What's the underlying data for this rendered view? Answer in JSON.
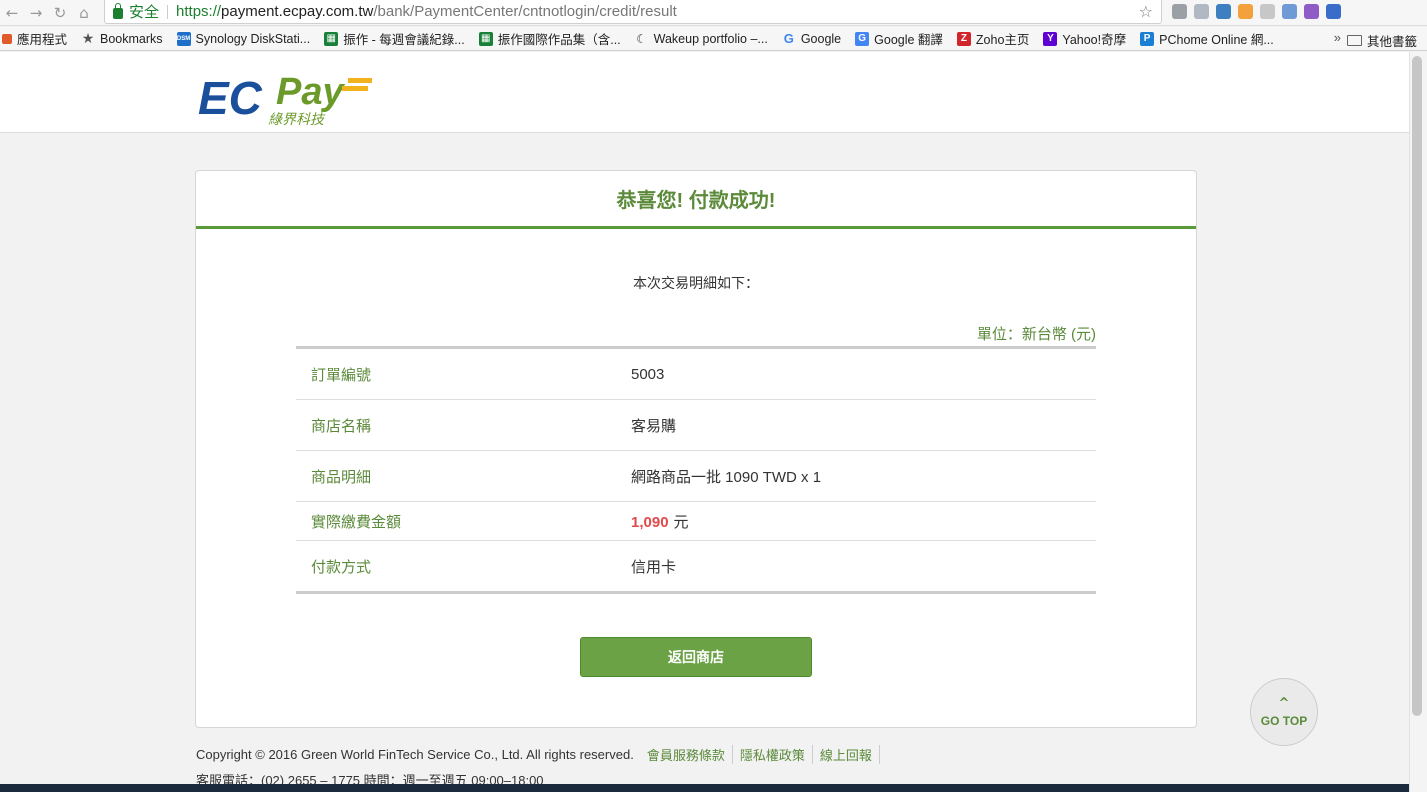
{
  "browser": {
    "secure_label": "安全",
    "url_https": "https://",
    "url_host": "payment.ecpay.com.tw",
    "url_path": "/bank/PaymentCenter/cntnotlogin/credit/result",
    "bookmarks": [
      {
        "label": "應用程式",
        "icon": "apps-icon",
        "color": "#e05a2b"
      },
      {
        "label": "Bookmarks",
        "icon": "star-icon",
        "color": "#555555"
      },
      {
        "label": "Synology DiskStati...",
        "icon": "synology-icon",
        "color": "#1e6fc9"
      },
      {
        "label": "振作 - 每週會議紀錄...",
        "icon": "sheets-icon",
        "color": "#188038"
      },
      {
        "label": "振作國際作品集（含...",
        "icon": "sheets-icon",
        "color": "#188038"
      },
      {
        "label": "Wakeup portfolio –...",
        "icon": "wakeup-icon",
        "color": "#333333"
      },
      {
        "label": "Google",
        "icon": "google-icon",
        "color": "#4285f4"
      },
      {
        "label": "Google 翻譯",
        "icon": "translate-icon",
        "color": "#4285f4"
      },
      {
        "label": "Zoho主页",
        "icon": "zoho-icon",
        "color": "#d4242b"
      },
      {
        "label": "Yahoo!奇摩",
        "icon": "yahoo-icon",
        "color": "#5f01d1"
      },
      {
        "label": "PChome Online 網...",
        "icon": "pchome-icon",
        "color": "#1a7fd4"
      }
    ],
    "bookmarks_more": "»",
    "other_bookmarks": "其他書籤"
  },
  "page": {
    "title": "恭喜您! 付款成功!",
    "subtitle": "本次交易明細如下：",
    "unit": "單位：新台幣 (元)",
    "rows": [
      {
        "label": "訂單編號",
        "value": "5003"
      },
      {
        "label": "商店名稱",
        "value": "客易購"
      },
      {
        "label": "商品明細",
        "value": "網路商品一批 1090 TWD x 1"
      },
      {
        "label": "實際繳費金額",
        "amount": "1,090",
        "currency": "元"
      },
      {
        "label": "付款方式",
        "value": "信用卡"
      }
    ],
    "return_button": "返回商店",
    "go_top": "GO TOP",
    "footer": {
      "copyright": "Copyright © 2016 Green World FinTech Service Co., Ltd. All rights reserved.",
      "links": [
        "會員服務條款",
        "隱私權政策",
        "線上回報"
      ],
      "contact": "客服電話：(02) 2655 – 1775   時間：週一至週五 09:00–18:00"
    }
  },
  "colors": {
    "accent_green": "#5b8a3a",
    "button_green": "#6aa245",
    "amount_red": "#e04a4a",
    "logo_blue": "#1a4f9c",
    "logo_green": "#6b9a2a",
    "logo_yellow": "#f2b21c"
  }
}
